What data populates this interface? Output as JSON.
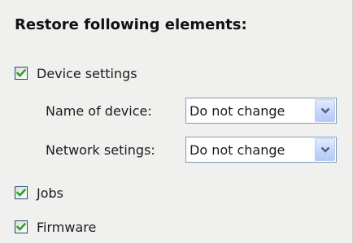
{
  "section_title": "Restore following elements:",
  "options": {
    "device_settings": {
      "label": "Device settings",
      "checked": true
    },
    "jobs": {
      "label": "Jobs",
      "checked": true
    },
    "firmware": {
      "label": "Firmware",
      "checked": true
    }
  },
  "fields": {
    "name_of_device": {
      "label": "Name of device:",
      "value": "Do not change"
    },
    "network_settings": {
      "label": "Network setings:",
      "value": "Do not change"
    }
  },
  "icons": {
    "checkbox_check": "checkmark-icon",
    "dropdown_arrow": "chevron-down-icon"
  },
  "colors": {
    "checkmark": "#21a121",
    "checkbox_border": "#1c5180",
    "dropdown_arrow": "#4d6185",
    "field_border": "#7f9db9",
    "panel_background": "#f0f0ef"
  }
}
